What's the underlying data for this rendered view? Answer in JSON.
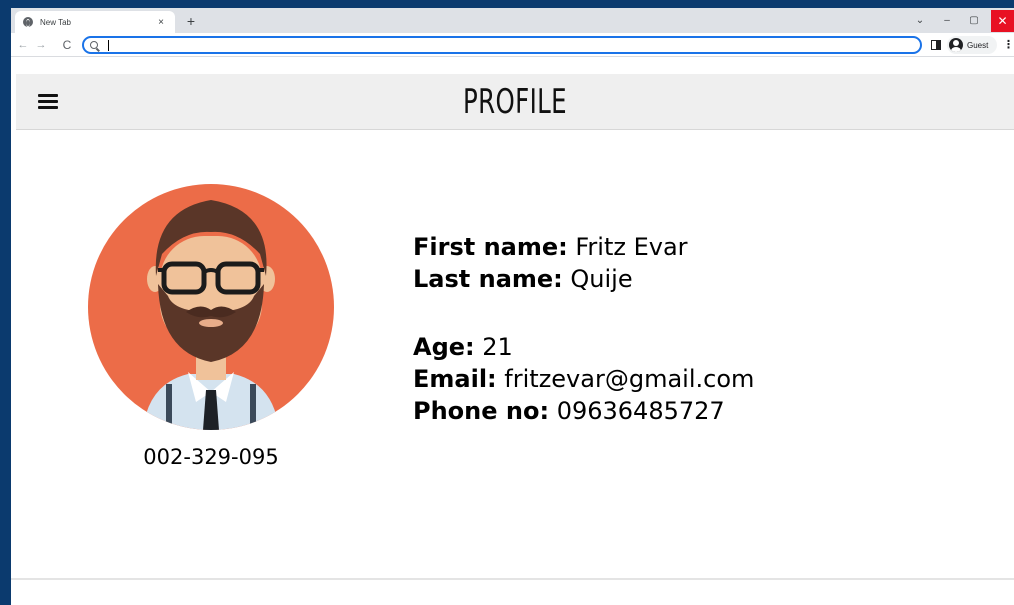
{
  "browser": {
    "tab_title": "New Tab",
    "tab_close": "×",
    "new_tab": "+",
    "address_value": "",
    "profile_label": "Guest",
    "window_controls": {
      "chevron": "⌄",
      "minimize": "–",
      "maximize": "▢",
      "close": "✕"
    },
    "nav": {
      "back": "←",
      "forward": "→",
      "reload": "C",
      "menu": "⋮"
    }
  },
  "app": {
    "title": "PROFILE"
  },
  "profile": {
    "id_number": "002-329-095",
    "fields": [
      {
        "label": "First name:",
        "value": "Fritz Evar"
      },
      {
        "label": "Last name:",
        "value": "Quije"
      },
      {
        "label": "Age:",
        "value": "21"
      },
      {
        "label": "Email:",
        "value": "fritzevar@gmail.com"
      },
      {
        "label": "Phone no:",
        "value": "09636485727"
      }
    ]
  },
  "colors": {
    "avatar_bg": "#ec6c48",
    "hair": "#5a3628",
    "skin": "#f0c29a",
    "shirt": "#d4e3ef",
    "header_bg": "#efefef"
  }
}
